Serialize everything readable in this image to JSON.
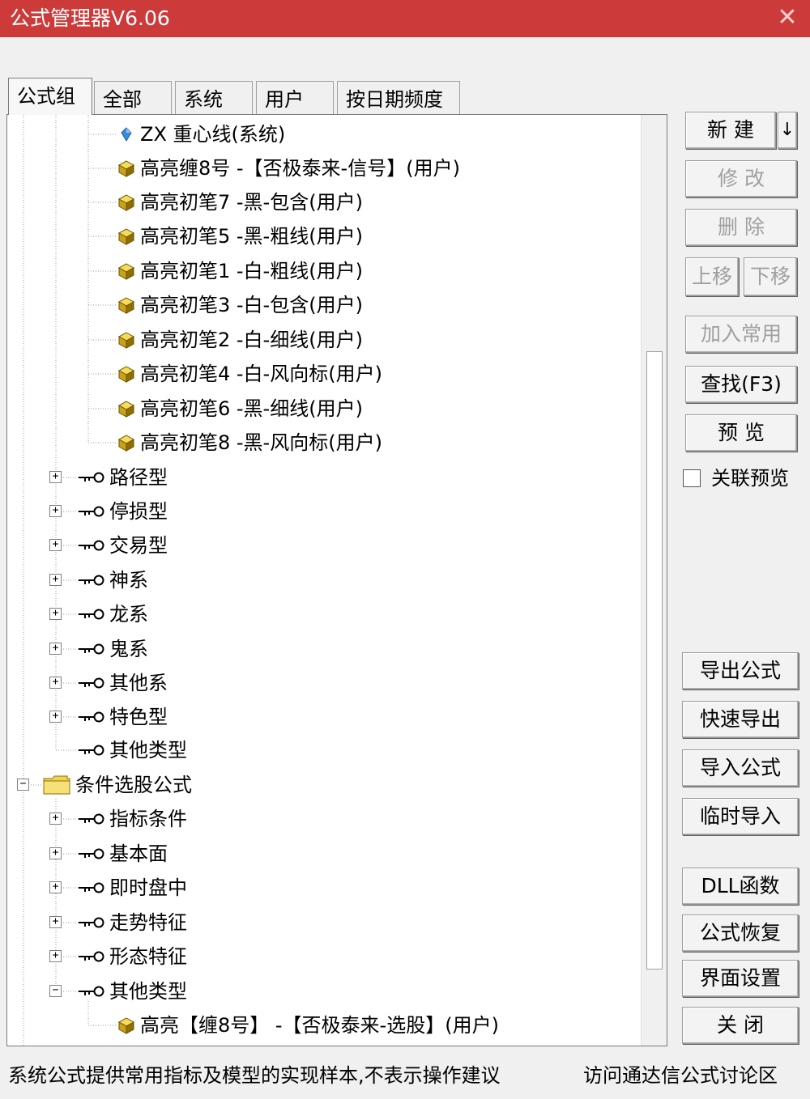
{
  "window": {
    "title": "公式管理器V6.06",
    "close_label": "✕"
  },
  "tabs": [
    {
      "label": "公式组",
      "active": true
    },
    {
      "label": "全部"
    },
    {
      "label": "系统"
    },
    {
      "label": "用户"
    },
    {
      "label": "按日期频度"
    }
  ],
  "tree": {
    "formula_items": [
      {
        "label": "ZX  重心线(系统)",
        "icon": "blue-diamond-icon"
      },
      {
        "label": "高亮缠8号  -【否极泰来-信号】(用户)",
        "icon": "yellow-cube-icon"
      },
      {
        "label": "高亮初笔7  -黑-包含(用户)",
        "icon": "yellow-cube-icon"
      },
      {
        "label": "高亮初笔5  -黑-粗线(用户)",
        "icon": "yellow-cube-icon"
      },
      {
        "label": "高亮初笔1  -白-粗线(用户)",
        "icon": "yellow-cube-icon"
      },
      {
        "label": "高亮初笔3  -白-包含(用户)",
        "icon": "yellow-cube-icon"
      },
      {
        "label": "高亮初笔2  -白-细线(用户)",
        "icon": "yellow-cube-icon"
      },
      {
        "label": "高亮初笔4  -白-风向标(用户)",
        "icon": "yellow-cube-icon"
      },
      {
        "label": "高亮初笔6  -黑-细线(用户)",
        "icon": "yellow-cube-icon"
      },
      {
        "label": "高亮初笔8  -黑-风向标(用户)",
        "icon": "yellow-cube-icon"
      }
    ],
    "groups_a": [
      {
        "label": "路径型",
        "toggle": "+"
      },
      {
        "label": "停损型",
        "toggle": "+"
      },
      {
        "label": "交易型",
        "toggle": "+"
      },
      {
        "label": "神系",
        "toggle": "+"
      },
      {
        "label": "龙系",
        "toggle": "+"
      },
      {
        "label": "鬼系",
        "toggle": "+"
      },
      {
        "label": "其他系",
        "toggle": "+"
      },
      {
        "label": "特色型",
        "toggle": "+"
      },
      {
        "label": "其他类型",
        "toggle": ""
      }
    ],
    "root_folder": {
      "label": "条件选股公式",
      "toggle": "−",
      "icon": "folder-icon"
    },
    "groups_b": [
      {
        "label": "指标条件",
        "toggle": "+"
      },
      {
        "label": "基本面",
        "toggle": "+"
      },
      {
        "label": "即时盘中",
        "toggle": "+"
      },
      {
        "label": "走势特征",
        "toggle": "+"
      },
      {
        "label": "形态特征",
        "toggle": "+"
      },
      {
        "label": "其他类型",
        "toggle": "−"
      }
    ],
    "last_item": {
      "label": "高亮【缠8号】  -【否极泰来-选股】(用户)",
      "icon": "yellow-cube-icon"
    }
  },
  "buttons": {
    "new": "新  建",
    "new_arrow": "↓",
    "modify": "修  改",
    "delete": "删  除",
    "move_up": "上移",
    "move_down": "下移",
    "add_common": "加入常用",
    "find": "查找(F3)",
    "preview": "预  览",
    "linked_preview": "关联预览",
    "export": "导出公式",
    "quick_export": "快速导出",
    "import": "导入公式",
    "temp_import": "临时导入",
    "dll": "DLL函数",
    "restore": "公式恢复",
    "ui_settings": "界面设置",
    "close": "关  闭"
  },
  "status": {
    "left": "系统公式提供常用指标及模型的实现样本,不表示操作建议",
    "right": "访问通达信公式讨论区"
  },
  "colors": {
    "titlebar": "#cc3a3a",
    "cube": "#e8c62a",
    "diamond": "#3a8ad8",
    "folder": "#f2d350"
  }
}
